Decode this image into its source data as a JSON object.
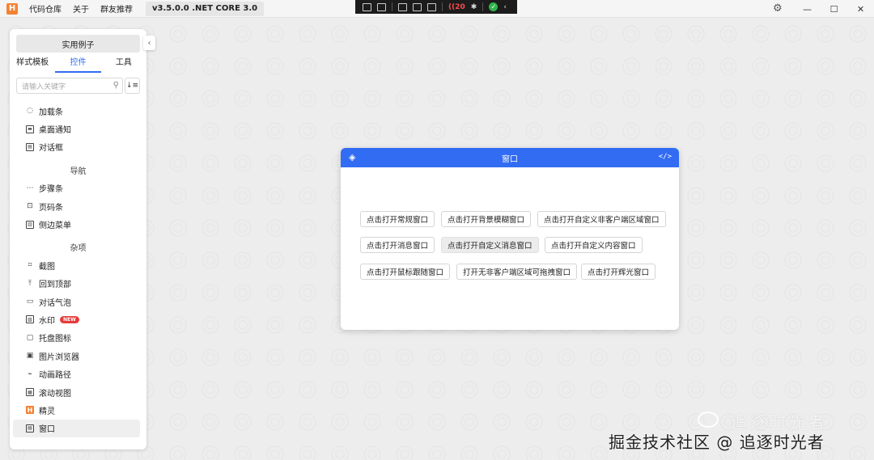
{
  "titlebar": {
    "logo_letter": "H",
    "menu": [
      "代码仓库",
      "关于",
      "群友推荐"
    ],
    "version": "v3.5.0.0 .NET CORE 3.0",
    "recorder_count": "20",
    "win_minimize": "—",
    "win_maximize": "☐",
    "win_close": "✕"
  },
  "sidebar": {
    "header": "实用例子",
    "tabs": [
      {
        "label": "样式模板",
        "active": false
      },
      {
        "label": "控件",
        "active": true
      },
      {
        "label": "工具",
        "active": false
      }
    ],
    "search_placeholder": "请输入关键字",
    "items_a": [
      {
        "label": "加载条",
        "icon": "spinner-icon"
      },
      {
        "label": "桌面通知",
        "icon": "notification-icon"
      },
      {
        "label": "对话框",
        "icon": "dialog-icon"
      }
    ],
    "group_nav": "导航",
    "items_b": [
      {
        "label": "步骤条",
        "icon": "steps-icon"
      },
      {
        "label": "页码条",
        "icon": "pagination-icon"
      },
      {
        "label": "侧边菜单",
        "icon": "side-menu-icon"
      }
    ],
    "group_misc": "杂项",
    "items_c": [
      {
        "label": "截图",
        "icon": "crop-icon"
      },
      {
        "label": "回到顶部",
        "icon": "arrow-up-icon"
      },
      {
        "label": "对话气泡",
        "icon": "chat-bubble-icon"
      },
      {
        "label": "水印",
        "icon": "watermark-icon",
        "badge": "NEW"
      },
      {
        "label": "托盘图标",
        "icon": "tray-icon"
      },
      {
        "label": "图片浏览器",
        "icon": "image-viewer-icon"
      },
      {
        "label": "动画路径",
        "icon": "animation-path-icon"
      },
      {
        "label": "滚动视图",
        "icon": "scroll-view-icon"
      },
      {
        "label": "精灵",
        "icon": "sprite-icon"
      },
      {
        "label": "窗口",
        "icon": "window-icon",
        "selected": true
      }
    ]
  },
  "modal": {
    "title": "窗口",
    "buttons": [
      "点击打开常规窗口",
      "点击打开背景模糊窗口",
      "点击打开自定义非客户端区域窗口",
      "点击打开消息窗口",
      "点击打开自定义消息窗口",
      "点击打开自定义内容窗口",
      "点击打开鼠标跟随窗口",
      "打开无非客户端区域可拖拽窗口",
      "点击打开辉光窗口"
    ]
  },
  "watermark": {
    "line1": "追逐时光者",
    "line2": "掘金技术社区 @ 追逐时光者"
  },
  "colors": {
    "accent": "#326cf3",
    "logo": "#f58232",
    "badge": "#e53b3b"
  }
}
